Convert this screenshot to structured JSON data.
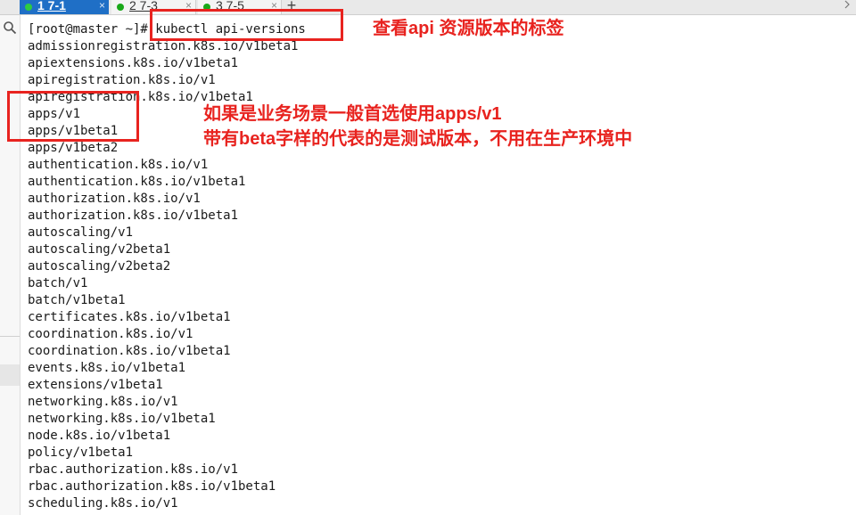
{
  "tabs": [
    {
      "label": "1 7-1",
      "active": true,
      "dot_color": "#2ecc40"
    },
    {
      "label": "2 7-3",
      "active": false,
      "dot_color": "#19a819"
    },
    {
      "label": "3 7-5",
      "active": false,
      "dot_color": "#19a819"
    }
  ],
  "tab_close_glyph": "×",
  "new_tab_glyph": "+",
  "terminal": {
    "lines": [
      "[root@master ~]# kubectl api-versions",
      "admissionregistration.k8s.io/v1beta1",
      "apiextensions.k8s.io/v1beta1",
      "apiregistration.k8s.io/v1",
      "apiregistration.k8s.io/v1beta1",
      "apps/v1",
      "apps/v1beta1",
      "apps/v1beta2",
      "authentication.k8s.io/v1",
      "authentication.k8s.io/v1beta1",
      "authorization.k8s.io/v1",
      "authorization.k8s.io/v1beta1",
      "autoscaling/v1",
      "autoscaling/v2beta1",
      "autoscaling/v2beta2",
      "batch/v1",
      "batch/v1beta1",
      "certificates.k8s.io/v1beta1",
      "coordination.k8s.io/v1",
      "coordination.k8s.io/v1beta1",
      "events.k8s.io/v1beta1",
      "extensions/v1beta1",
      "networking.k8s.io/v1",
      "networking.k8s.io/v1beta1",
      "node.k8s.io/v1beta1",
      "policy/v1beta1",
      "rbac.authorization.k8s.io/v1",
      "rbac.authorization.k8s.io/v1beta1",
      "scheduling.k8s.io/v1"
    ]
  },
  "annotations": {
    "note_1": "查看api 资源版本的标签",
    "note_2": "如果是业务场景一般首选使用apps/v1",
    "note_3": "带有beta字样的代表的是测试版本，不用在生产环境中",
    "color": "#e8231f"
  },
  "icons": {
    "gutter": "search-icon",
    "tab_close": "close-icon",
    "new_tab": "plus-icon"
  }
}
